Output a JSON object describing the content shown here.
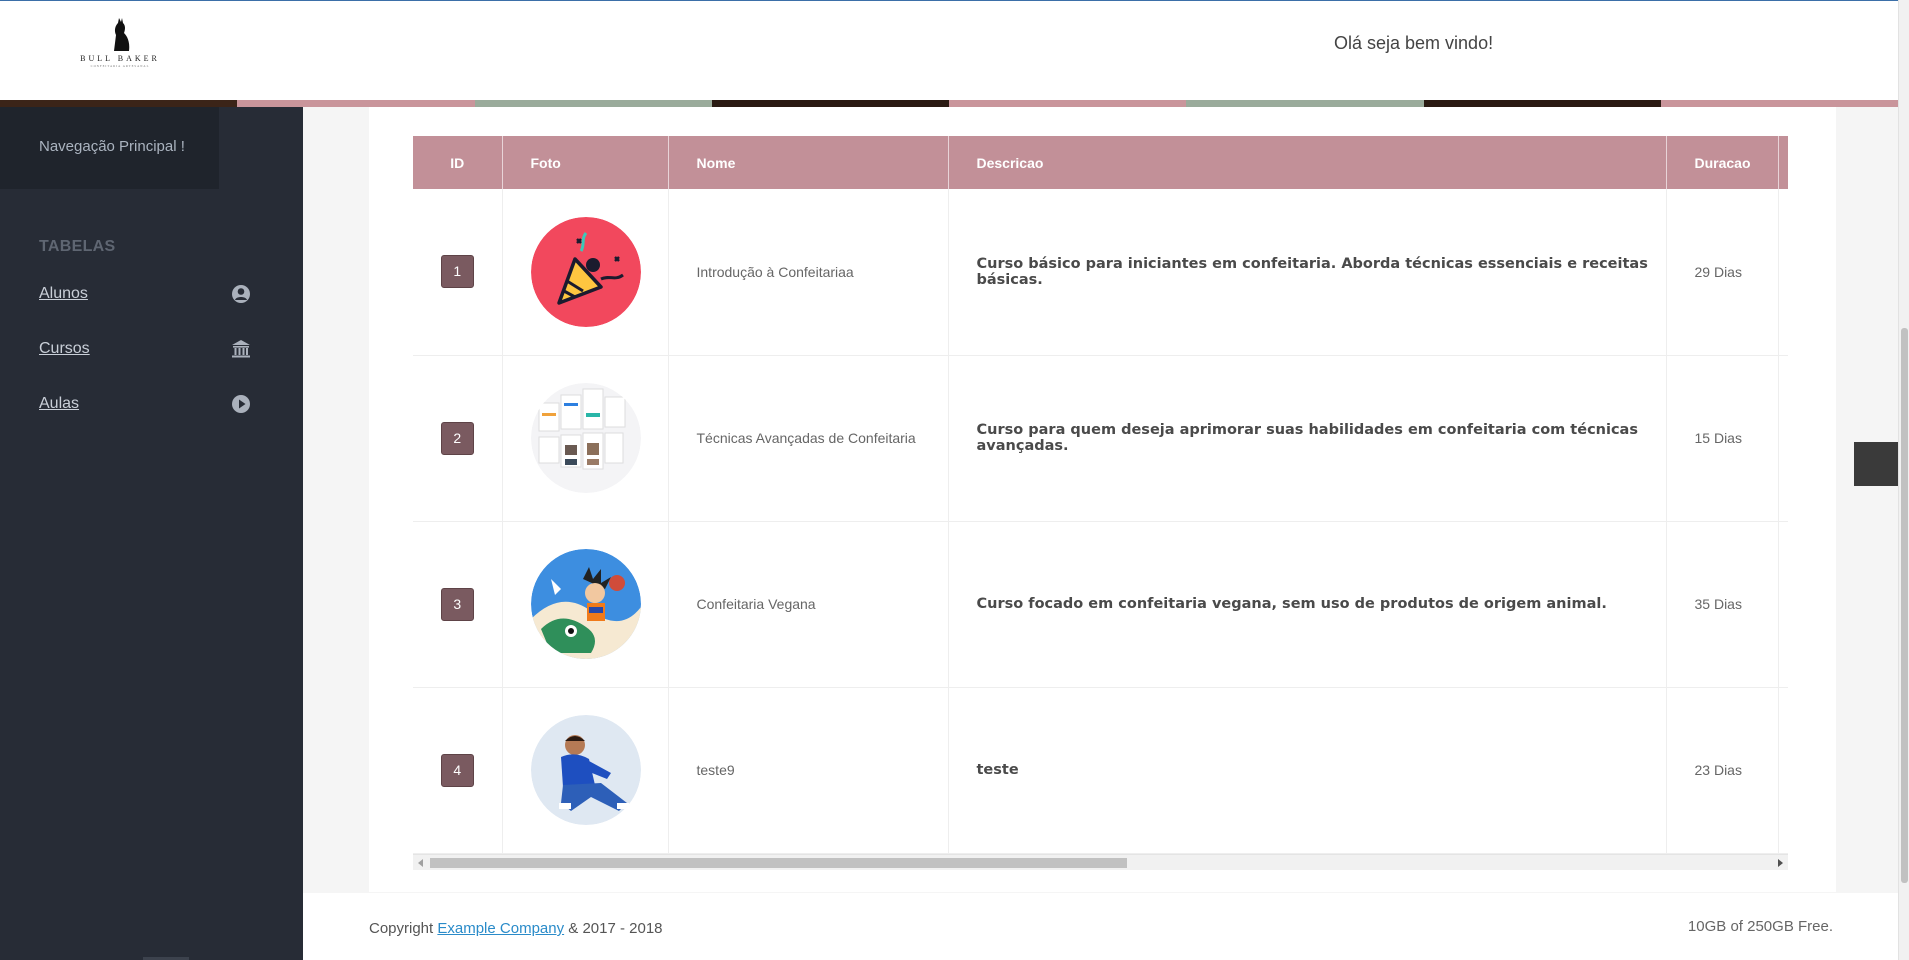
{
  "header": {
    "logo_name": "BULL BAKER",
    "logo_tagline": "CONFEITARIA ARTESANAL",
    "welcome": "Olá seja bem vindo!",
    "stripe_colors": [
      "#3b2418",
      "#c9959b",
      "#9aab9b",
      "#2a1a12",
      "#c9959b",
      "#9aab9b",
      "#2a1a12",
      "#c9959b"
    ]
  },
  "sidebar": {
    "title": "Navegação Principal !",
    "section": "TABELAS",
    "items": [
      {
        "label": "Alunos",
        "icon": "user-circle-icon"
      },
      {
        "label": "Cursos",
        "icon": "bank-icon"
      },
      {
        "label": "Aulas",
        "icon": "play-circle-icon"
      }
    ]
  },
  "table": {
    "headers": {
      "id": "ID",
      "foto": "Foto",
      "nome": "Nome",
      "descricao": "Descricao",
      "duracao": "Duracao"
    },
    "rows": [
      {
        "id": "1",
        "nome": "Introdução à Confeitariaa",
        "descricao": "Curso básico para iniciantes em confeitaria. Aborda técnicas essenciais e receitas básicas.",
        "duracao": "29 Dias",
        "foto": "party-popper-icon"
      },
      {
        "id": "2",
        "nome": "Técnicas Avançadas de Confeitaria",
        "descricao": "Curso para quem deseja aprimorar suas habilidades em confeitaria com técnicas avançadas.",
        "duracao": "15 Dias",
        "foto": "app-screens-thumbnail"
      },
      {
        "id": "3",
        "nome": "Confeitaria Vegana",
        "descricao": "Curso focado em confeitaria vegana, sem uso de produtos de origem animal.",
        "duracao": "35 Dias",
        "foto": "cartoon-illustration"
      },
      {
        "id": "4",
        "nome": "teste9",
        "descricao": "teste",
        "duracao": "23 Dias",
        "foto": "person-photo"
      }
    ]
  },
  "footer": {
    "copyright_prefix": "Copyright",
    "company_link": "Example Company",
    "copyright_suffix": "& 2017 - 2018",
    "storage": "10GB of 250GB Free."
  },
  "colors": {
    "header_row": "#c29098",
    "id_badge": "#7a5a60",
    "sidebar": "#272c36",
    "link": "#2a8bc9"
  }
}
